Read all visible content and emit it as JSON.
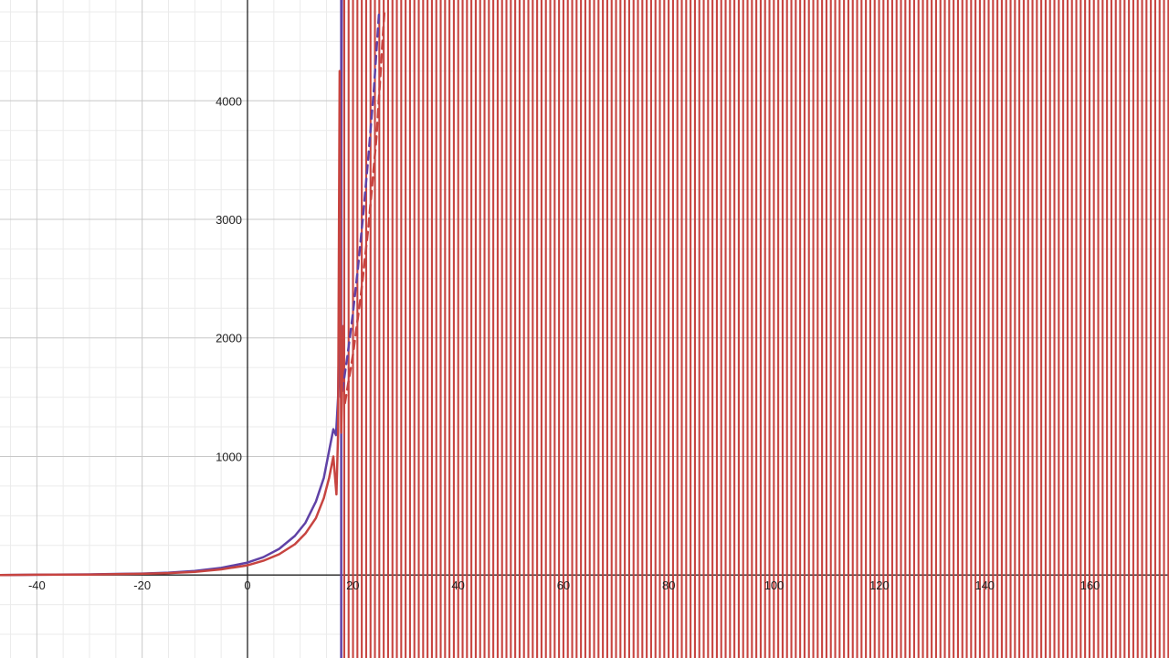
{
  "chart_data": {
    "type": "line",
    "title": "",
    "xlabel": "",
    "ylabel": "",
    "xlim": [
      -47,
      175
    ],
    "ylim": [
      -700,
      4850
    ],
    "grid": true,
    "x_ticks": [
      -40,
      -20,
      0,
      20,
      40,
      60,
      80,
      100,
      120,
      140,
      160
    ],
    "y_ticks": [
      1000,
      2000,
      3000,
      4000
    ],
    "x_tick_labels": [
      "-40",
      "-20",
      "0",
      "20",
      "40",
      "60",
      "80",
      "100",
      "120",
      "140",
      "160"
    ],
    "y_tick_labels": [
      "1000",
      "2000",
      "3000",
      "4000"
    ],
    "colors": {
      "purple": "#6042a6",
      "red": "#c74440",
      "major_grid": "#c8c8c8",
      "minor_grid": "#ebebeb",
      "axis": "#222222"
    },
    "series": [
      {
        "color": "purple",
        "style": "solid",
        "x": [
          -47,
          -40,
          -30,
          -20,
          -15,
          -10,
          -5,
          0,
          3,
          6,
          9,
          11,
          13,
          14.5,
          15.5,
          16.3,
          16.8,
          17.2,
          17.5,
          17.7,
          17.9
        ],
        "y": [
          0,
          2,
          5,
          12,
          20,
          34,
          60,
          105,
          150,
          220,
          330,
          440,
          620,
          820,
          1050,
          1230,
          1180,
          1500,
          2330,
          1500,
          4850
        ]
      },
      {
        "color": "purple",
        "style": "dashed",
        "x": [
          18,
          19,
          20,
          21,
          22,
          23,
          24,
          25
        ],
        "y": [
          1550,
          1850,
          2200,
          2600,
          3050,
          3550,
          4100,
          4750
        ]
      },
      {
        "color": "red",
        "style": "solid",
        "x": [
          -47,
          -40,
          -30,
          -20,
          -15,
          -10,
          -5,
          0,
          3,
          6,
          9,
          11,
          13,
          14.5,
          15.5,
          16.3,
          16.9,
          17.2,
          17.5,
          17.8,
          18.2
        ],
        "y": [
          0,
          2,
          4,
          10,
          16,
          27,
          48,
          82,
          120,
          175,
          260,
          350,
          480,
          650,
          820,
          1000,
          680,
          1200,
          4250,
          1200,
          2100
        ]
      },
      {
        "color": "red",
        "style": "dashed",
        "x": [
          18.5,
          20,
          21.5,
          23,
          24.5,
          26
        ],
        "y": [
          1450,
          1850,
          2350,
          2950,
          3700,
          4750
        ]
      }
    ],
    "oscillation_region": {
      "x_start": 18.2,
      "x_end": 175,
      "y_min": -700,
      "y_max": 4850,
      "color": "red",
      "description_only": false
    }
  }
}
